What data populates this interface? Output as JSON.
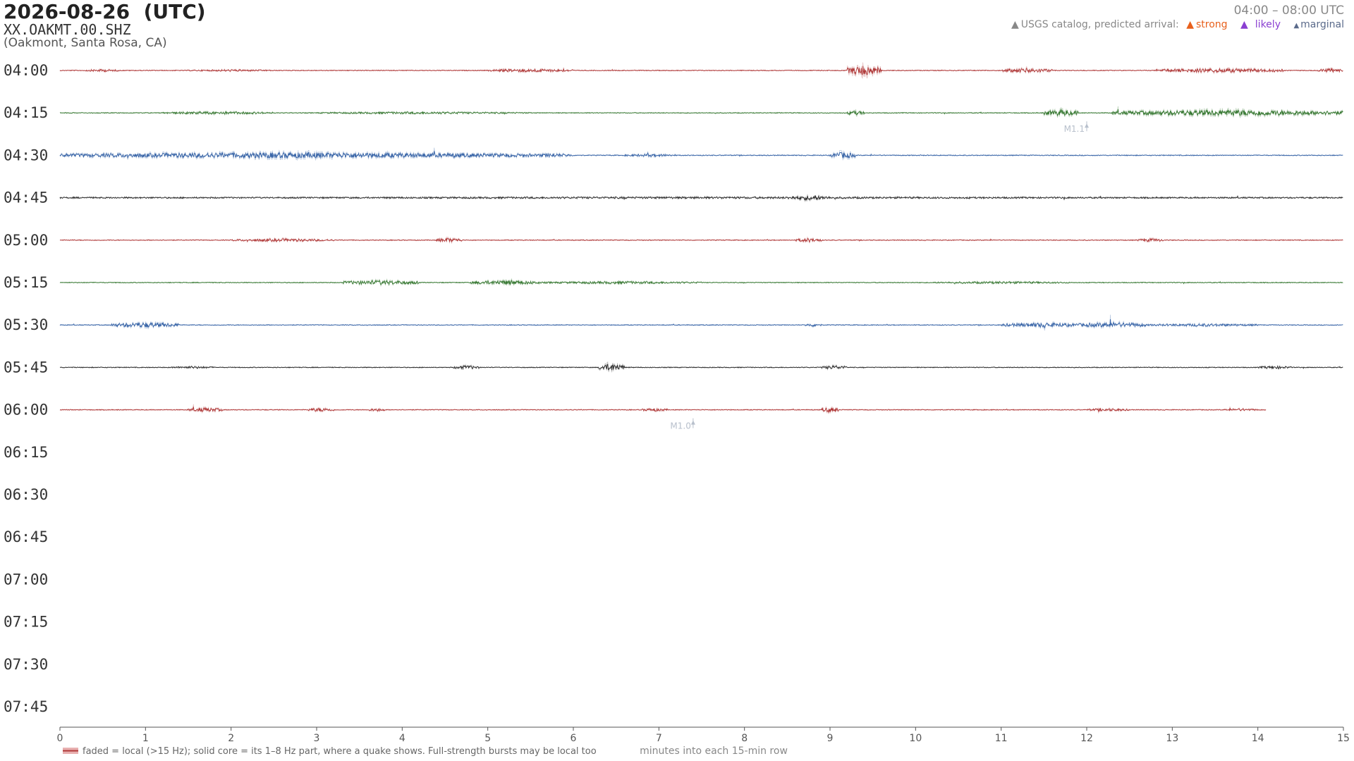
{
  "header": {
    "title": "2026-08-26  (UTC)",
    "channel": "XX.OAKMT.00.SHZ",
    "location": "(Oakmont, Santa Rosa, CA)",
    "time_range": "04:00 – 08:00 UTC"
  },
  "legend": {
    "intro": "USGS catalog, predicted arrival:",
    "strong": "strong",
    "likely": "likely",
    "marginal": "marginal",
    "colors": {
      "intro": "#888888",
      "strong": "#e8601c",
      "likely": "#8a3fd1",
      "marginal": "#5a6a8a"
    }
  },
  "chart_data": {
    "type": "line",
    "title": "2026-08-26  (UTC)",
    "xlabel": "minutes into each 15-min row",
    "ylabel": "",
    "xlim": [
      0,
      15
    ],
    "x_ticks": [
      "0",
      "1",
      "2",
      "3",
      "4",
      "5",
      "6",
      "7",
      "8",
      "9",
      "10",
      "11",
      "12",
      "13",
      "14",
      "15"
    ],
    "row_labels": [
      "04:00",
      "04:15",
      "04:30",
      "04:45",
      "05:00",
      "05:15",
      "05:30",
      "05:45",
      "06:00",
      "06:15",
      "06:30",
      "06:45",
      "07:00",
      "07:15",
      "07:30",
      "07:45"
    ],
    "series": [
      {
        "row": "04:00",
        "color": "#b03a3a",
        "end_minute": 15,
        "base_amp": 0.45,
        "bursts": [
          [
            0.3,
            0.7,
            1.6
          ],
          [
            1.5,
            2.5,
            1.2
          ],
          [
            5.0,
            6.0,
            2.2
          ],
          [
            9.2,
            9.6,
            7.0
          ],
          [
            11.0,
            11.6,
            3.0
          ],
          [
            12.8,
            14.3,
            2.8
          ],
          [
            14.7,
            15,
            2.5
          ]
        ]
      },
      {
        "row": "04:15",
        "color": "#3a7a35",
        "end_minute": 15,
        "base_amp": 0.45,
        "bursts": [
          [
            1.2,
            2.5,
            1.8
          ],
          [
            3.0,
            5.5,
            1.4
          ],
          [
            9.2,
            9.4,
            3.0
          ],
          [
            11.5,
            11.9,
            4.5
          ],
          [
            12.3,
            15,
            4.2
          ]
        ]
      },
      {
        "row": "04:30",
        "color": "#3a66a8",
        "end_minute": 15,
        "base_amp": 0.5,
        "bursts": [
          [
            0,
            5.5,
            4.0
          ],
          [
            5.5,
            6.0,
            2.5
          ],
          [
            6.6,
            7.2,
            1.8
          ],
          [
            9.0,
            9.3,
            4.5
          ]
        ]
      },
      {
        "row": "04:45",
        "color": "#303030",
        "end_minute": 15,
        "base_amp": 0.8,
        "bursts": [
          [
            0,
            15,
            1.2
          ],
          [
            8.5,
            9.0,
            3.2
          ]
        ]
      },
      {
        "row": "05:00",
        "color": "#b03a3a",
        "end_minute": 15,
        "base_amp": 0.45,
        "bursts": [
          [
            2.0,
            3.2,
            1.9
          ],
          [
            4.4,
            4.7,
            3.0
          ],
          [
            8.6,
            8.9,
            2.6
          ],
          [
            12.6,
            12.9,
            2.2
          ]
        ]
      },
      {
        "row": "05:15",
        "color": "#3a7a35",
        "end_minute": 15,
        "base_amp": 0.45,
        "bursts": [
          [
            3.3,
            4.2,
            3.0
          ],
          [
            4.8,
            5.6,
            3.0
          ],
          [
            5.6,
            7.5,
            1.6
          ],
          [
            10.2,
            11.8,
            1.4
          ]
        ]
      },
      {
        "row": "05:30",
        "color": "#3a66a8",
        "end_minute": 15,
        "base_amp": 0.45,
        "bursts": [
          [
            0.6,
            1.4,
            3.5
          ],
          [
            8.7,
            8.9,
            2.0
          ],
          [
            11.0,
            12.0,
            3.0
          ],
          [
            11.9,
            12.7,
            3.5
          ],
          [
            12.7,
            14.0,
            1.8
          ]
        ]
      },
      {
        "row": "05:45",
        "color": "#303030",
        "end_minute": 15,
        "base_amp": 0.45,
        "bursts": [
          [
            1.3,
            1.8,
            1.5
          ],
          [
            4.6,
            4.9,
            2.4
          ],
          [
            6.3,
            6.6,
            5.2
          ],
          [
            8.9,
            9.2,
            2.5
          ],
          [
            14.0,
            14.4,
            1.8
          ]
        ]
      },
      {
        "row": "06:00",
        "color": "#b03a3a",
        "end_minute": 14.1,
        "base_amp": 0.45,
        "bursts": [
          [
            1.5,
            1.9,
            2.8
          ],
          [
            2.9,
            3.2,
            2.5
          ],
          [
            3.6,
            3.8,
            2.0
          ],
          [
            6.8,
            7.1,
            2.0
          ],
          [
            8.9,
            9.1,
            3.5
          ],
          [
            12.0,
            12.5,
            1.8
          ],
          [
            13.6,
            14.0,
            1.6
          ]
        ]
      }
    ],
    "events": [
      {
        "row": "04:15",
        "minute": 12.0,
        "label": "M1.1",
        "class": "marginal"
      },
      {
        "row": "06:00",
        "minute": 7.4,
        "label": "M1.0",
        "class": "marginal"
      }
    ],
    "footnote": "faded = local (>15 Hz); solid core = its 1–8 Hz part, where a quake shows. Full-strength bursts may be local too",
    "grid": false
  }
}
